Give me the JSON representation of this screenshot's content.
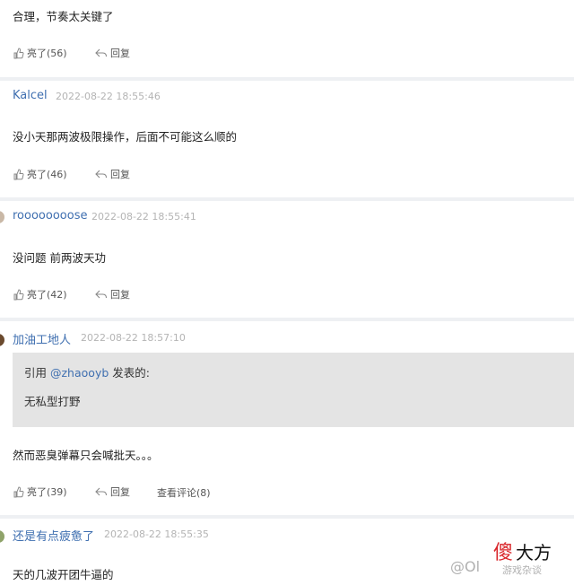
{
  "comments": [
    {
      "username": "",
      "time": "",
      "text": "合理，节奏太关键了",
      "like": "亮了(56)",
      "reply": "回复"
    },
    {
      "username": "Kalcel",
      "time": "2022-08-22 18:55:46",
      "text": "没小天那两波极限操作，后面不可能这么顺的",
      "like": "亮了(46)",
      "reply": "回复"
    },
    {
      "username": "roooooooose",
      "time": "2022-08-22 18:55:41",
      "text": "没问题 前两波天功",
      "like": "亮了(42)",
      "reply": "回复"
    },
    {
      "username": "加油工地人",
      "time": "2022-08-22 18:57:10",
      "quote": {
        "prefix": "引用",
        "user": "@zhaooyb",
        "suffix": "发表的:",
        "text": "无私型打野"
      },
      "text": "然而恶臭弹幕只会喊批天。。。",
      "like": "亮了(39)",
      "reply": "回复",
      "view_comments": "查看评论(8)"
    },
    {
      "username": "还是有点疲惫了",
      "time": "2022-08-22 18:55:35",
      "text": "天的几波开团牛逼的"
    }
  ],
  "watermark": {
    "brand_red": "傻",
    "brand_black": "大方",
    "faded": "@Ol",
    "faded2": "游戏杂谈"
  },
  "colors": {
    "username": "#3f6fb0",
    "separator": "#eef0f3",
    "quote_bg": "#e4e4e4",
    "brand_red": "#d9262b"
  }
}
